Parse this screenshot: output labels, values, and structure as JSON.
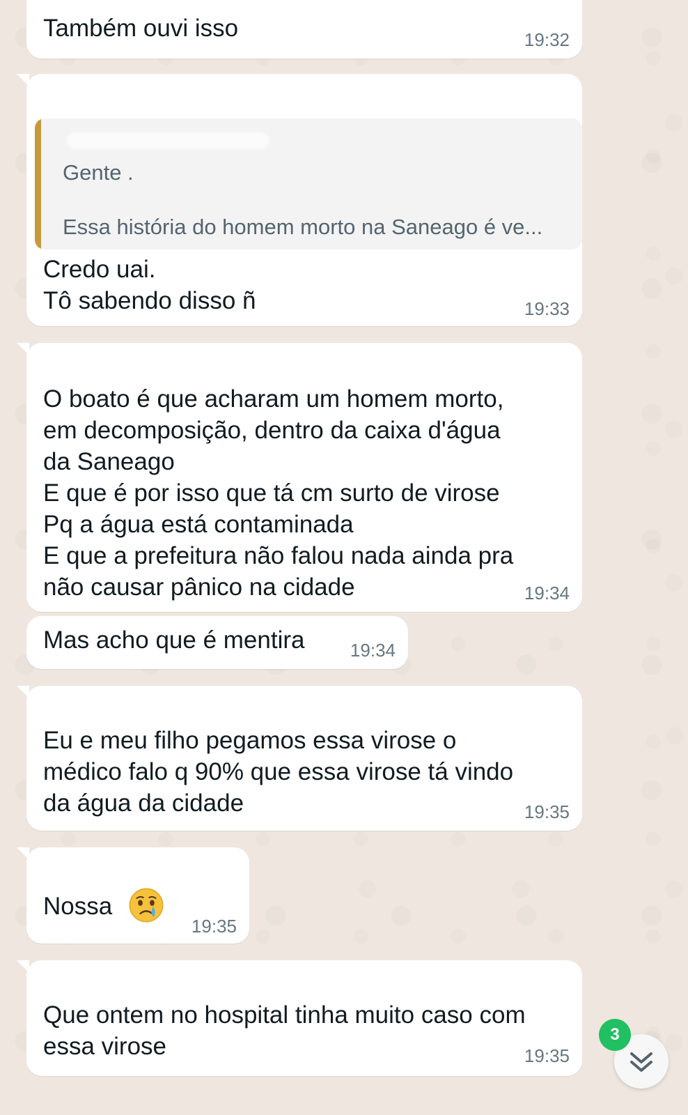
{
  "theme": {
    "bubble_color": "#ffffff",
    "wallpaper_color": "#efe7df",
    "quote_accent": "#c49a3c",
    "badge_color": "#21c063",
    "time_color": "#667781"
  },
  "messages": [
    {
      "text": "Também ouvi isso",
      "time": "19:32"
    },
    {
      "reply_to": {
        "sender": "",
        "lines": [
          "Gente .",
          "Essa história do homem morto na Saneago é ve..."
        ]
      },
      "text": "Credo uai.\nTô sabendo disso ñ",
      "time": "19:33"
    },
    {
      "text": "O boato é que acharam um homem morto,\nem decomposição, dentro da caixa d'água\nda Saneago\nE que é por isso que tá cm surto de virose\nPq a água está contaminada\nE que a prefeitura não falou nada ainda pra\nnão causar pânico na cidade",
      "time": "19:34"
    },
    {
      "text": "Mas acho que é mentira",
      "time": "19:34"
    },
    {
      "text": "Eu e meu filho pegamos essa virose o\nmédico falo q 90% que essa virose tá vindo\nda água da cidade",
      "time": "19:35"
    },
    {
      "text": "Nossa",
      "emoji": "crying-face",
      "time": "19:35"
    },
    {
      "text": "Que ontem no hospital tinha muito caso com\nessa virose",
      "time": "19:35"
    }
  ],
  "scroll_button": {
    "icon": "double-chevron-down-icon",
    "unread_count": "3"
  }
}
